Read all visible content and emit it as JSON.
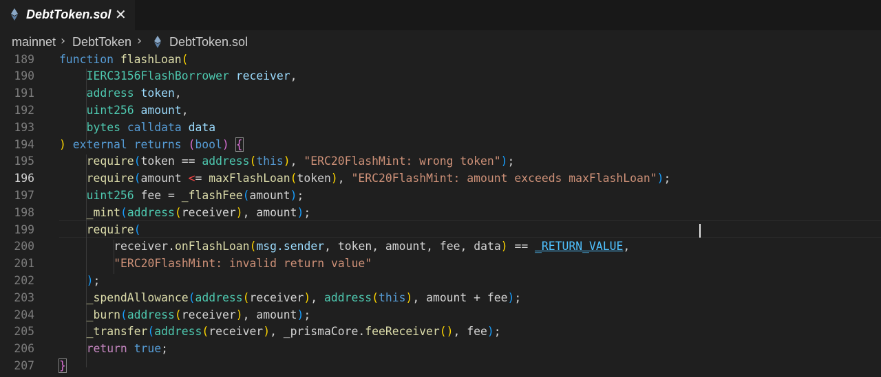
{
  "tab": {
    "title": "DebtToken.sol",
    "close": "✕"
  },
  "breadcrumb": {
    "items": [
      "mainnet",
      "DebtToken",
      "DebtToken.sol"
    ],
    "separator": "›"
  },
  "editor": {
    "active_line": 196,
    "lines": [
      {
        "n": "189",
        "tokens": [
          [
            "kw",
            "function"
          ],
          [
            "op",
            " "
          ],
          [
            "fn",
            "flashLoan"
          ],
          [
            "p1",
            "("
          ]
        ]
      },
      {
        "n": "190",
        "tokens": [
          [
            "ty",
            "IERC3156FlashBorrower"
          ],
          [
            "op",
            " "
          ],
          [
            "var",
            "receiver"
          ],
          [
            "op",
            ","
          ]
        ]
      },
      {
        "n": "191",
        "tokens": [
          [
            "ty",
            "address"
          ],
          [
            "op",
            " "
          ],
          [
            "var",
            "token"
          ],
          [
            "op",
            ","
          ]
        ]
      },
      {
        "n": "192",
        "tokens": [
          [
            "ty",
            "uint256"
          ],
          [
            "op",
            " "
          ],
          [
            "var",
            "amount"
          ],
          [
            "op",
            ","
          ]
        ]
      },
      {
        "n": "193",
        "tokens": [
          [
            "ty",
            "bytes"
          ],
          [
            "op",
            " "
          ],
          [
            "kw",
            "calldata"
          ],
          [
            "op",
            " "
          ],
          [
            "var",
            "data"
          ]
        ]
      },
      {
        "n": "194",
        "tokens": [
          [
            "p1",
            ")"
          ],
          [
            "op",
            " "
          ],
          [
            "kw",
            "external"
          ],
          [
            "op",
            " "
          ],
          [
            "kw",
            "returns"
          ],
          [
            "op",
            " "
          ],
          [
            "p2",
            "("
          ],
          [
            "kw",
            "bool"
          ],
          [
            "p2",
            ")"
          ],
          [
            "op",
            " "
          ],
          [
            "p2m",
            "{"
          ]
        ]
      },
      {
        "n": "195",
        "tokens": [
          [
            "fn",
            "require"
          ],
          [
            "p3",
            "("
          ],
          [
            "op",
            "token == "
          ],
          [
            "ty",
            "address"
          ],
          [
            "p1",
            "("
          ],
          [
            "kw",
            "this"
          ],
          [
            "p1",
            ")"
          ],
          [
            "op",
            ", "
          ],
          [
            "str",
            "\"ERC20FlashMint: wrong token\""
          ],
          [
            "p3",
            ")"
          ],
          [
            "op",
            ";"
          ]
        ]
      },
      {
        "n": "196",
        "tokens": [
          [
            "fn",
            "require"
          ],
          [
            "p3",
            "("
          ],
          [
            "op",
            "amount "
          ],
          [
            "lt",
            "<"
          ],
          [
            "op",
            "= "
          ],
          [
            "fn",
            "maxFlashLoan"
          ],
          [
            "p1",
            "("
          ],
          [
            "op",
            "token"
          ],
          [
            "p1",
            ")"
          ],
          [
            "op",
            ", "
          ],
          [
            "str",
            "\"ERC20FlashMint: amount exceeds maxFlashLoan\""
          ],
          [
            "p3",
            ")"
          ],
          [
            "op",
            ";"
          ]
        ]
      },
      {
        "n": "197",
        "tokens": [
          [
            "ty",
            "uint256"
          ],
          [
            "op",
            " fee = "
          ],
          [
            "fn",
            "_flashFee"
          ],
          [
            "p3",
            "("
          ],
          [
            "op",
            "amount"
          ],
          [
            "p3",
            ")"
          ],
          [
            "op",
            ";"
          ]
        ]
      },
      {
        "n": "198",
        "tokens": [
          [
            "fn",
            "_mint"
          ],
          [
            "p3",
            "("
          ],
          [
            "ty",
            "address"
          ],
          [
            "p1",
            "("
          ],
          [
            "op",
            "receiver"
          ],
          [
            "p1",
            ")"
          ],
          [
            "op",
            ", amount"
          ],
          [
            "p3",
            ")"
          ],
          [
            "op",
            ";"
          ]
        ]
      },
      {
        "n": "199",
        "tokens": [
          [
            "fn",
            "require"
          ],
          [
            "p3",
            "("
          ]
        ]
      },
      {
        "n": "200",
        "tokens": [
          [
            "op",
            "receiver."
          ],
          [
            "fn",
            "onFlashLoan"
          ],
          [
            "p1",
            "("
          ],
          [
            "var",
            "msg.sender"
          ],
          [
            "op",
            ", token, amount, fee, data"
          ],
          [
            "p1",
            ")"
          ],
          [
            "op",
            " == "
          ],
          [
            "cstu",
            "_RETURN_VALUE"
          ],
          [
            "op",
            ","
          ]
        ]
      },
      {
        "n": "201",
        "tokens": [
          [
            "str",
            "\"ERC20FlashMint: invalid return value\""
          ]
        ]
      },
      {
        "n": "202",
        "tokens": [
          [
            "p3",
            ")"
          ],
          [
            "op",
            ";"
          ]
        ]
      },
      {
        "n": "203",
        "tokens": [
          [
            "fn",
            "_spendAllowance"
          ],
          [
            "p3",
            "("
          ],
          [
            "ty",
            "address"
          ],
          [
            "p1",
            "("
          ],
          [
            "op",
            "receiver"
          ],
          [
            "p1",
            ")"
          ],
          [
            "op",
            ", "
          ],
          [
            "ty",
            "address"
          ],
          [
            "p1",
            "("
          ],
          [
            "kw",
            "this"
          ],
          [
            "p1",
            ")"
          ],
          [
            "op",
            ", amount + fee"
          ],
          [
            "p3",
            ")"
          ],
          [
            "op",
            ";"
          ]
        ]
      },
      {
        "n": "204",
        "tokens": [
          [
            "fn",
            "_burn"
          ],
          [
            "p3",
            "("
          ],
          [
            "ty",
            "address"
          ],
          [
            "p1",
            "("
          ],
          [
            "op",
            "receiver"
          ],
          [
            "p1",
            ")"
          ],
          [
            "op",
            ", amount"
          ],
          [
            "p3",
            ")"
          ],
          [
            "op",
            ";"
          ]
        ]
      },
      {
        "n": "205",
        "tokens": [
          [
            "fn",
            "_transfer"
          ],
          [
            "p3",
            "("
          ],
          [
            "ty",
            "address"
          ],
          [
            "p1",
            "("
          ],
          [
            "op",
            "receiver"
          ],
          [
            "p1",
            ")"
          ],
          [
            "op",
            ", _prismaCore."
          ],
          [
            "fn",
            "feeReceiver"
          ],
          [
            "p1",
            "()"
          ],
          [
            "op",
            ", fee"
          ],
          [
            "p3",
            ")"
          ],
          [
            "op",
            ";"
          ]
        ]
      },
      {
        "n": "206",
        "tokens": [
          [
            "kw2",
            "return"
          ],
          [
            "op",
            " "
          ],
          [
            "kw",
            "true"
          ],
          [
            "op",
            ";"
          ]
        ]
      },
      {
        "n": "207",
        "tokens": [
          [
            "p2m",
            "}"
          ]
        ]
      }
    ]
  },
  "colors": {
    "keyword": "#569cd6",
    "function": "#dcdcaa",
    "type": "#4ec9b0",
    "variable": "#9cdcfe",
    "string": "#ce9178",
    "bracket1": "#ffd700",
    "bracket2": "#da70d6",
    "bracket3": "#179fff"
  }
}
